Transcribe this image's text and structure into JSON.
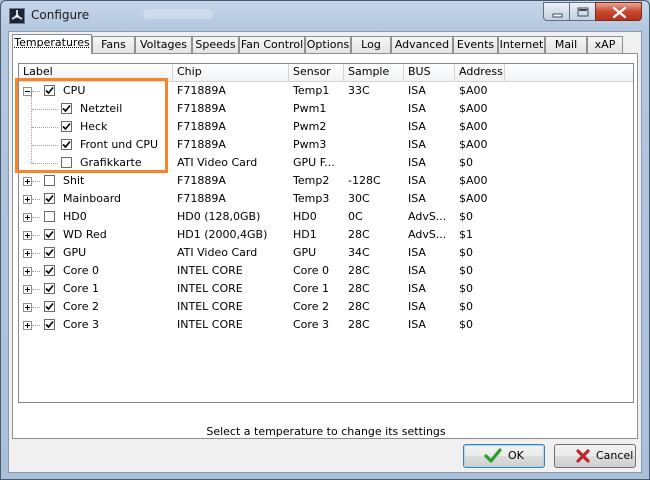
{
  "window": {
    "title": "Configure"
  },
  "tabs": [
    {
      "label": "Temperatures",
      "active": true
    },
    {
      "label": "Fans"
    },
    {
      "label": "Voltages"
    },
    {
      "label": "Speeds"
    },
    {
      "label": "Fan Control"
    },
    {
      "label": "Options"
    },
    {
      "label": "Log"
    },
    {
      "label": "Advanced"
    },
    {
      "label": "Events"
    },
    {
      "label": "Internet"
    },
    {
      "label": "Mail"
    },
    {
      "label": "xAP"
    }
  ],
  "table": {
    "columns": [
      "Label",
      "Chip",
      "Sensor",
      "Sample",
      "BUS",
      "Address"
    ],
    "rows": [
      {
        "label": "CPU",
        "checked": true,
        "expander": "minus",
        "child": false,
        "chip": "F71889A",
        "sensor": "Temp1",
        "sample": "33C",
        "bus": "ISA",
        "address": "$A00"
      },
      {
        "label": "Netzteil",
        "checked": true,
        "child": true,
        "chip": "F71889A",
        "sensor": "Pwm1",
        "sample": "",
        "bus": "ISA",
        "address": "$A00"
      },
      {
        "label": "Heck",
        "checked": true,
        "child": true,
        "chip": "F71889A",
        "sensor": "Pwm2",
        "sample": "",
        "bus": "ISA",
        "address": "$A00"
      },
      {
        "label": "Front und CPU",
        "checked": true,
        "child": true,
        "chip": "F71889A",
        "sensor": "Pwm3",
        "sample": "",
        "bus": "ISA",
        "address": "$A00"
      },
      {
        "label": "Grafikkarte",
        "checked": false,
        "child": true,
        "chip": "ATI Video Card",
        "sensor": "GPU F...",
        "sample": "",
        "bus": "ISA",
        "address": "$0"
      },
      {
        "label": "Shit",
        "checked": false,
        "expander": "plus",
        "child": false,
        "chip": "F71889A",
        "sensor": "Temp2",
        "sample": "-128C",
        "bus": "ISA",
        "address": "$A00"
      },
      {
        "label": "Mainboard",
        "checked": true,
        "expander": "plus",
        "child": false,
        "chip": "F71889A",
        "sensor": "Temp3",
        "sample": "30C",
        "bus": "ISA",
        "address": "$A00"
      },
      {
        "label": "HD0",
        "checked": false,
        "expander": "plus",
        "child": false,
        "chip": "HD0 (128,0GB)",
        "sensor": "HD0",
        "sample": "0C",
        "bus": "AdvS...",
        "address": "$0"
      },
      {
        "label": "WD Red",
        "checked": true,
        "expander": "plus",
        "child": false,
        "chip": "HD1 (2000,4GB)",
        "sensor": "HD1",
        "sample": "28C",
        "bus": "AdvS...",
        "address": "$1"
      },
      {
        "label": "GPU",
        "checked": true,
        "expander": "plus",
        "child": false,
        "chip": "ATI Video Card",
        "sensor": "GPU",
        "sample": "34C",
        "bus": "ISA",
        "address": "$0"
      },
      {
        "label": "Core 0",
        "checked": true,
        "expander": "plus",
        "child": false,
        "chip": "INTEL CORE",
        "sensor": "Core 0",
        "sample": "28C",
        "bus": "ISA",
        "address": "$0"
      },
      {
        "label": "Core 1",
        "checked": true,
        "expander": "plus",
        "child": false,
        "chip": "INTEL CORE",
        "sensor": "Core 1",
        "sample": "28C",
        "bus": "ISA",
        "address": "$0"
      },
      {
        "label": "Core 2",
        "checked": true,
        "expander": "plus",
        "child": false,
        "chip": "INTEL CORE",
        "sensor": "Core 2",
        "sample": "28C",
        "bus": "ISA",
        "address": "$0"
      },
      {
        "label": "Core 3",
        "checked": true,
        "expander": "plus",
        "child": false,
        "chip": "INTEL CORE",
        "sensor": "Core 3",
        "sample": "28C",
        "bus": "ISA",
        "address": "$0"
      }
    ]
  },
  "status_text": "Select a temperature to change its settings",
  "buttons": {
    "ok": "OK",
    "cancel": "Cancel"
  },
  "colors": {
    "highlight": "#f5842a",
    "ok_check": "#2a9d2a",
    "cancel_x": "#c0262d"
  },
  "icons": {
    "ok": "check-icon",
    "cancel": "x-icon"
  }
}
